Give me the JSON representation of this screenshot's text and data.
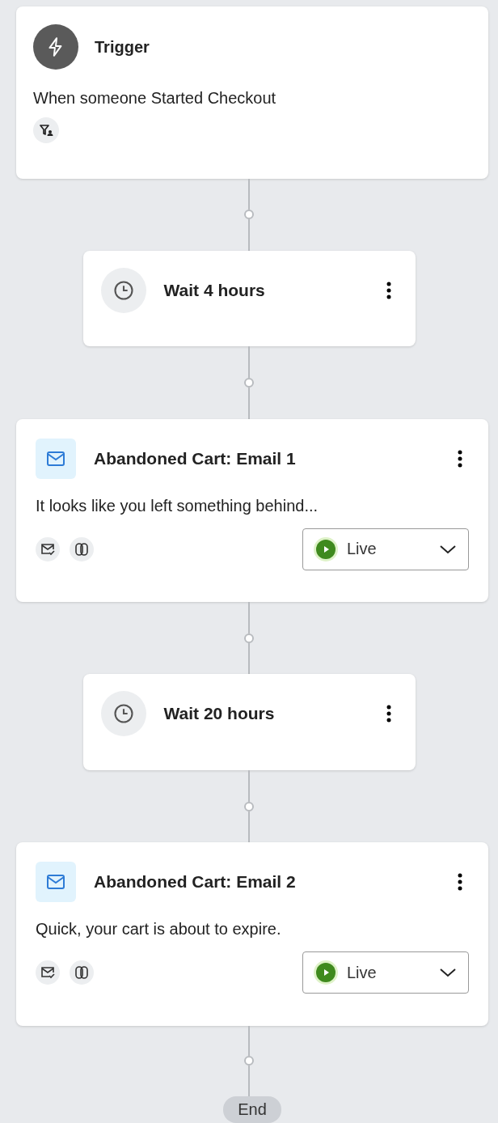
{
  "steps": [
    {
      "kind": "trigger",
      "title": "Trigger",
      "description": "When someone Started Checkout"
    },
    {
      "kind": "wait",
      "title": "Wait 4 hours"
    },
    {
      "kind": "email",
      "title": "Abandoned Cart: Email 1",
      "description": "It looks like you left something behind...",
      "status": {
        "label": "Live",
        "live": true
      }
    },
    {
      "kind": "wait",
      "title": "Wait 20 hours"
    },
    {
      "kind": "email",
      "title": "Abandoned Cart: Email 2",
      "description": "Quick, your cart is about to expire.",
      "status": {
        "label": "Live",
        "live": true
      }
    }
  ],
  "end_label": "End"
}
